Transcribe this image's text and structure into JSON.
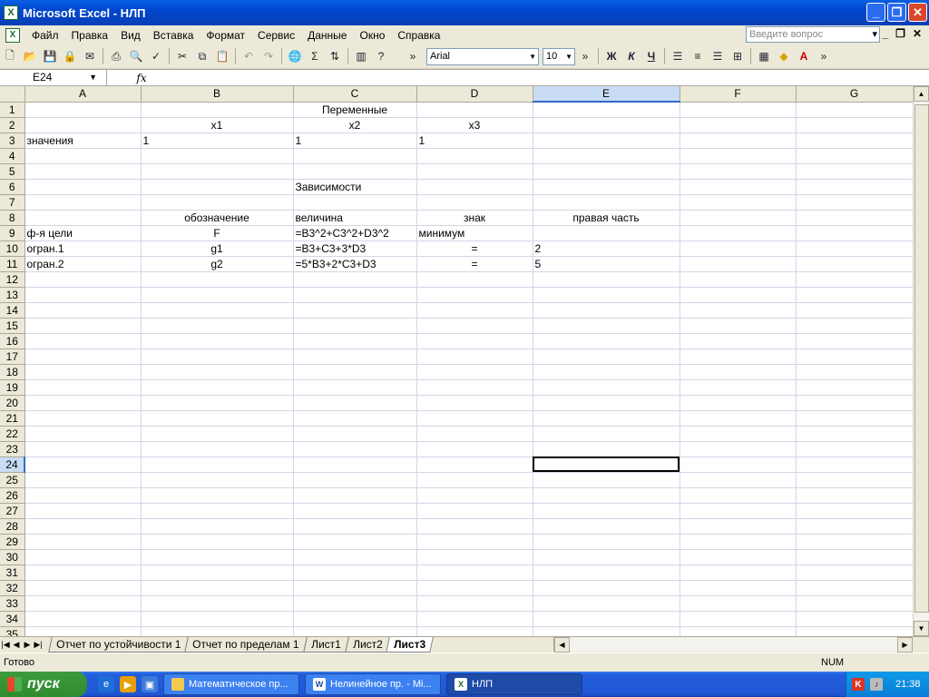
{
  "window": {
    "title": "Microsoft Excel - НЛП"
  },
  "menu": [
    "Файл",
    "Правка",
    "Вид",
    "Вставка",
    "Формат",
    "Сервис",
    "Данные",
    "Окно",
    "Справка"
  ],
  "help_box": {
    "placeholder": "Введите вопрос"
  },
  "toolbar": {
    "font": "Arial",
    "size": "10",
    "bold": "Ж",
    "italic": "К",
    "underline": "Ч"
  },
  "formula_bar": {
    "name_box": "E24",
    "fx": "fx",
    "value": ""
  },
  "columns": [
    "A",
    "B",
    "C",
    "D",
    "E",
    "F",
    "G"
  ],
  "active_cell": "E24",
  "rows": [
    {
      "n": "1",
      "A": "",
      "B": "",
      "C": "Переменные",
      "D": "",
      "E": "",
      "F": "",
      "G": ""
    },
    {
      "n": "2",
      "A": "",
      "B": "x1",
      "C": "x2",
      "D": "x3",
      "E": "",
      "F": "",
      "G": ""
    },
    {
      "n": "3",
      "A": "значения",
      "B": "1",
      "C": "1",
      "D": "1",
      "E": "",
      "F": "",
      "G": ""
    },
    {
      "n": "4",
      "A": "",
      "B": "",
      "C": "",
      "D": "",
      "E": "",
      "F": "",
      "G": ""
    },
    {
      "n": "5",
      "A": "",
      "B": "",
      "C": "",
      "D": "",
      "E": "",
      "F": "",
      "G": ""
    },
    {
      "n": "6",
      "A": "",
      "B": "",
      "C": "Зависимости",
      "D": "",
      "E": "",
      "F": "",
      "G": ""
    },
    {
      "n": "7",
      "A": "",
      "B": "",
      "C": "",
      "D": "",
      "E": "",
      "F": "",
      "G": ""
    },
    {
      "n": "8",
      "A": "",
      "B": "обозначение",
      "C": "величина",
      "D": "знак",
      "E": "правая часть",
      "F": "",
      "G": ""
    },
    {
      "n": "9",
      "A": "ф-я цели",
      "B": "F",
      "C": "=B3^2+C3^2+D3^2",
      "D": "минимум",
      "E": "",
      "F": "",
      "G": ""
    },
    {
      "n": "10",
      "A": "огран.1",
      "B": "g1",
      "C": "=B3+C3+3*D3",
      "D": "=",
      "E": "2",
      "F": "",
      "G": ""
    },
    {
      "n": "11",
      "A": "огран.2",
      "B": "g2",
      "C": "=5*B3+2*C3+D3",
      "D": "=",
      "E": "5",
      "F": "",
      "G": ""
    }
  ],
  "total_rows": 35,
  "sheet_tabs": [
    {
      "label": "Отчет по устойчивости 1",
      "active": false
    },
    {
      "label": "Отчет по пределам 1",
      "active": false
    },
    {
      "label": "Лист1",
      "active": false
    },
    {
      "label": "Лист2",
      "active": false
    },
    {
      "label": "Лист3",
      "active": true
    }
  ],
  "status": {
    "text": "Готово",
    "num": "NUM"
  },
  "taskbar": {
    "start": "пуск",
    "tasks": [
      {
        "label": "Математическое пр...",
        "active": false
      },
      {
        "label": "Нелинейное пр. - Mi...",
        "active": false
      },
      {
        "label": "НЛП",
        "active": true
      }
    ],
    "clock": "21:38"
  }
}
